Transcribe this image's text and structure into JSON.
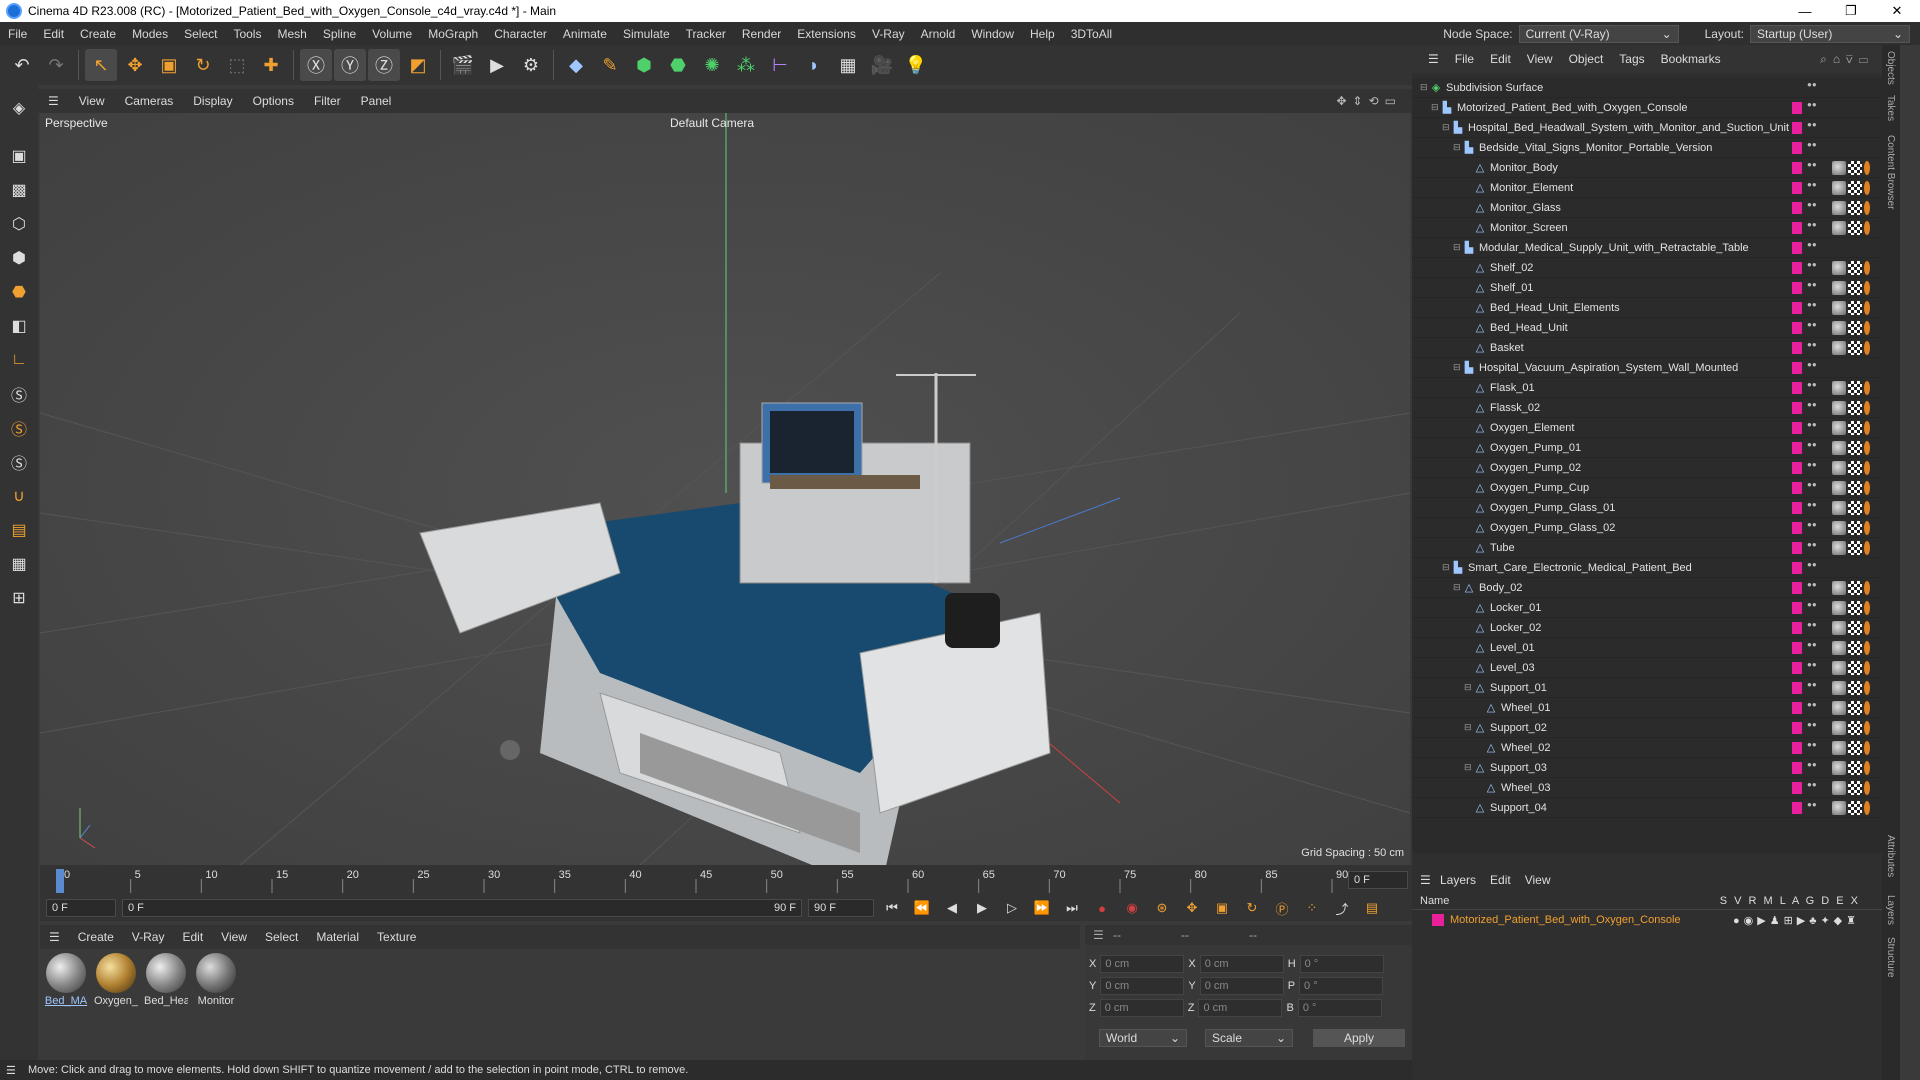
{
  "window": {
    "title": "Cinema 4D R23.008 (RC) - [Motorized_Patient_Bed_with_Oxygen_Console_c4d_vray.c4d *] - Main",
    "minimize": "—",
    "maximize": "❐",
    "close": "✕"
  },
  "menubar": {
    "items": [
      "File",
      "Edit",
      "Create",
      "Modes",
      "Select",
      "Tools",
      "Mesh",
      "Spline",
      "Volume",
      "MoGraph",
      "Character",
      "Animate",
      "Simulate",
      "Tracker",
      "Render",
      "Extensions",
      "V-Ray",
      "Arnold",
      "Window",
      "Help",
      "3DToAll"
    ],
    "node_space_label": "Node Space:",
    "node_space_value": "Current (V-Ray)",
    "layout_label": "Layout:",
    "layout_value": "Startup (User)"
  },
  "viewport": {
    "menu": [
      "View",
      "Cameras",
      "Display",
      "Options",
      "Filter",
      "Panel"
    ],
    "label": "Perspective",
    "camera": "Default Camera",
    "grid_spacing": "Grid Spacing : 50 cm"
  },
  "timeline": {
    "ticks": [
      "0",
      "5",
      "10",
      "15",
      "20",
      "25",
      "30",
      "35",
      "40",
      "45",
      "50",
      "55",
      "60",
      "65",
      "70",
      "75",
      "80",
      "85",
      "90"
    ],
    "current_frame": "0 F",
    "start_frame": "0 F",
    "range_start": "0 F",
    "range_end": "90 F",
    "end_frame": "90 F"
  },
  "materials": {
    "menu": [
      "Create",
      "V-Ray",
      "Edit",
      "View",
      "Select",
      "Material",
      "Texture"
    ],
    "items": [
      "Bed_MA",
      "Oxygen_",
      "Bed_Hea",
      "Monitor"
    ]
  },
  "attributes": {
    "header": [
      "--",
      "--",
      "--"
    ],
    "rows": [
      {
        "a": "X",
        "av": "0 cm",
        "b": "X",
        "bv": "0 cm",
        "c": "H",
        "cv": "0 °"
      },
      {
        "a": "Y",
        "av": "0 cm",
        "b": "Y",
        "bv": "0 cm",
        "c": "P",
        "cv": "0 °"
      },
      {
        "a": "Z",
        "av": "0 cm",
        "b": "Z",
        "bv": "0 cm",
        "c": "B",
        "cv": "0 °"
      }
    ],
    "world": "World",
    "scale": "Scale",
    "apply": "Apply"
  },
  "status": "Move: Click and drag to move elements. Hold down SHIFT to quantize movement / add to the selection in point mode, CTRL to remove.",
  "objects": {
    "menu": [
      "File",
      "Edit",
      "View",
      "Object",
      "Tags",
      "Bookmarks"
    ],
    "tree": [
      {
        "name": "Subdivision Surface",
        "indent": 0,
        "tags": 0
      },
      {
        "name": "Motorized_Patient_Bed_with_Oxygen_Console",
        "indent": 1,
        "tags": 0
      },
      {
        "name": "Hospital_Bed_Headwall_System_with_Monitor_and_Suction_Unit",
        "indent": 2,
        "tags": 0
      },
      {
        "name": "Bedside_Vital_Signs_Monitor_Portable_Version",
        "indent": 3,
        "tags": 0
      },
      {
        "name": "Monitor_Body",
        "indent": 4,
        "tags": 1
      },
      {
        "name": "Monitor_Element",
        "indent": 4,
        "tags": 1
      },
      {
        "name": "Monitor_Glass",
        "indent": 4,
        "tags": 1
      },
      {
        "name": "Monitor_Screen",
        "indent": 4,
        "tags": 1
      },
      {
        "name": "Modular_Medical_Supply_Unit_with_Retractable_Table",
        "indent": 3,
        "tags": 0
      },
      {
        "name": "Shelf_02",
        "indent": 4,
        "tags": 1
      },
      {
        "name": "Shelf_01",
        "indent": 4,
        "tags": 1
      },
      {
        "name": "Bed_Head_Unit_Elements",
        "indent": 4,
        "tags": 1
      },
      {
        "name": "Bed_Head_Unit",
        "indent": 4,
        "tags": 1
      },
      {
        "name": "Basket",
        "indent": 4,
        "tags": 1
      },
      {
        "name": "Hospital_Vacuum_Aspiration_System_Wall_Mounted",
        "indent": 3,
        "tags": 0
      },
      {
        "name": "Flask_01",
        "indent": 4,
        "tags": 1
      },
      {
        "name": "Flassk_02",
        "indent": 4,
        "tags": 1
      },
      {
        "name": "Oxygen_Element",
        "indent": 4,
        "tags": 1
      },
      {
        "name": "Oxygen_Pump_01",
        "indent": 4,
        "tags": 1
      },
      {
        "name": "Oxygen_Pump_02",
        "indent": 4,
        "tags": 1
      },
      {
        "name": "Oxygen_Pump_Cup",
        "indent": 4,
        "tags": 1
      },
      {
        "name": "Oxygen_Pump_Glass_01",
        "indent": 4,
        "tags": 1
      },
      {
        "name": "Oxygen_Pump_Glass_02",
        "indent": 4,
        "tags": 1
      },
      {
        "name": "Tube",
        "indent": 4,
        "tags": 1
      },
      {
        "name": "Smart_Care_Electronic_Medical_Patient_Bed",
        "indent": 2,
        "tags": 0
      },
      {
        "name": "Body_02",
        "indent": 3,
        "tags": 1
      },
      {
        "name": "Locker_01",
        "indent": 4,
        "tags": 1
      },
      {
        "name": "Locker_02",
        "indent": 4,
        "tags": 1
      },
      {
        "name": "Level_01",
        "indent": 4,
        "tags": 1
      },
      {
        "name": "Level_03",
        "indent": 4,
        "tags": 1
      },
      {
        "name": "Support_01",
        "indent": 4,
        "tags": 1
      },
      {
        "name": "Wheel_01",
        "indent": 5,
        "tags": 1
      },
      {
        "name": "Support_02",
        "indent": 4,
        "tags": 1
      },
      {
        "name": "Wheel_02",
        "indent": 5,
        "tags": 1
      },
      {
        "name": "Support_03",
        "indent": 4,
        "tags": 1
      },
      {
        "name": "Wheel_03",
        "indent": 5,
        "tags": 1
      },
      {
        "name": "Support_04",
        "indent": 4,
        "tags": 1
      }
    ]
  },
  "layers": {
    "menu": [
      "Layers",
      "Edit",
      "View"
    ],
    "col_name": "Name",
    "cols": "S V R M L A G D E X",
    "item": "Motorized_Patient_Bed_with_Oxygen_Console"
  },
  "side_tabs": [
    "Objects",
    "Takes",
    "Content Browser",
    "Attributes",
    "Layers",
    "Structure"
  ],
  "colors": {
    "layer_color": "#e8209c",
    "accent": "#9ec7ff"
  }
}
